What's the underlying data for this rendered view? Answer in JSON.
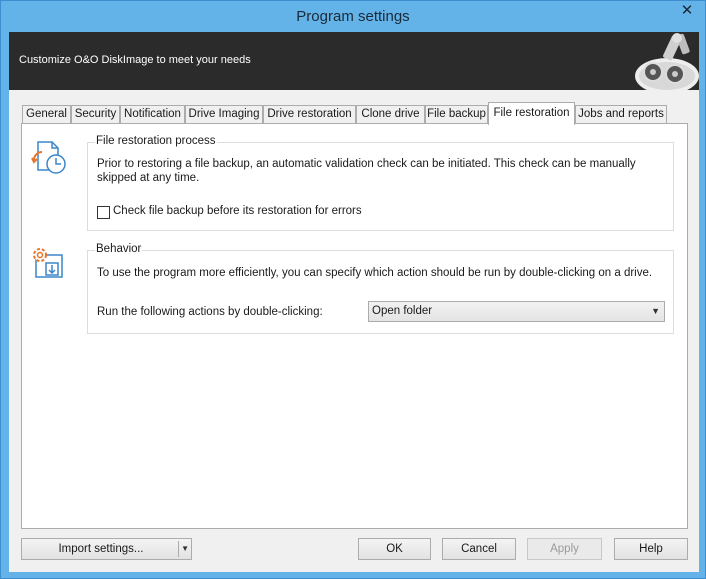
{
  "window": {
    "title": "Program settings",
    "close_glyph": "✕"
  },
  "banner": {
    "text": "Customize O&O DiskImage to meet your needs",
    "art_icon": "drives-robot-icon"
  },
  "tabs": [
    {
      "label": "General"
    },
    {
      "label": "Security"
    },
    {
      "label": "Notification"
    },
    {
      "label": "Drive Imaging"
    },
    {
      "label": "Drive restoration"
    },
    {
      "label": "Clone drive"
    },
    {
      "label": "File backup"
    },
    {
      "label": "File restoration",
      "active": true
    },
    {
      "label": "Jobs and reports"
    }
  ],
  "file_restoration": {
    "title": "File restoration process",
    "icon": "file-restore-clock-icon",
    "description": "Prior to restoring a file backup, an automatic validation check can be initiated. This check can be manually skipped at any time.",
    "checkbox_label": "Check file backup before its restoration for errors",
    "checkbox_checked": false
  },
  "behavior": {
    "title": "Behavior",
    "icon": "gear-window-icon",
    "description": "To use the program more efficiently, you can specify which action should be run by double-clicking on a drive.",
    "action_label": "Run the following actions by double-clicking:",
    "action_value": "Open folder"
  },
  "footer": {
    "import_label": "Import settings...",
    "ok_label": "OK",
    "cancel_label": "Cancel",
    "apply_label": "Apply",
    "help_label": "Help"
  },
  "colors": {
    "frame": "#64b3e8",
    "banner": "#2b2b2b",
    "icon_accent": "#e8742a",
    "icon_blue": "#3a86c8"
  }
}
